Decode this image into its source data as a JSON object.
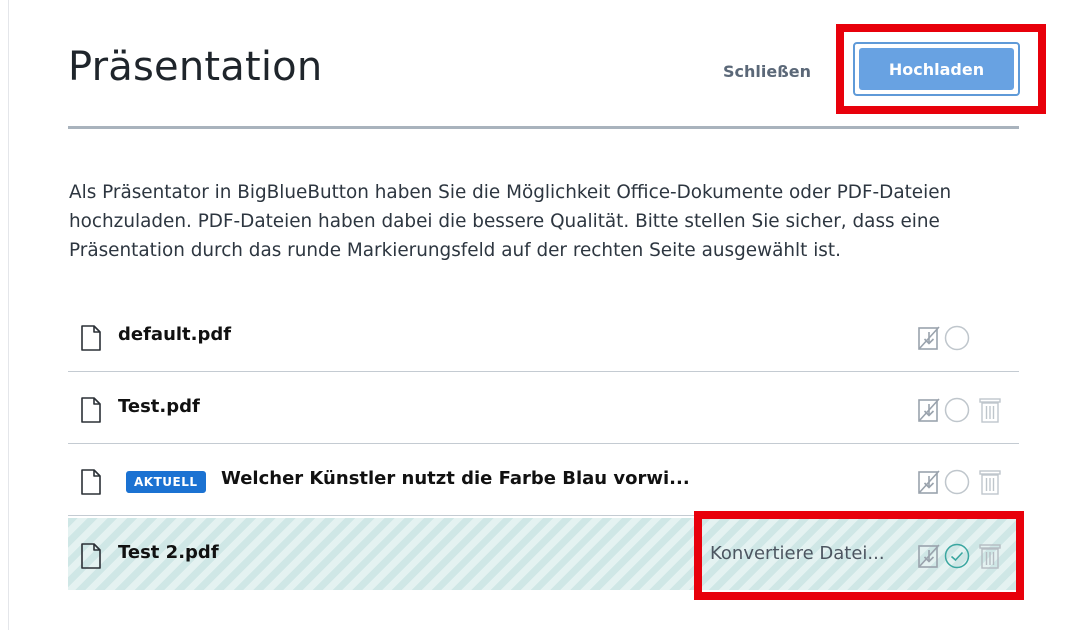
{
  "header": {
    "title": "Präsentation",
    "close_label": "Schließen",
    "upload_label": "Hochladen"
  },
  "description": "Als Präsentator in BigBlueButton haben Sie die Möglichkeit Office-Dokumente oder PDF-Dateien hochzuladen. PDF-Dateien haben dabei die bessere Qualität. Bitte stellen Sie sicher, dass eine Präsentation durch das runde Markierungsfeld auf der rechten Seite ausgewählt ist.",
  "files": [
    {
      "name": "default.pdf",
      "badge": "",
      "status": "",
      "selected": false,
      "deletable": false
    },
    {
      "name": "Test.pdf",
      "badge": "",
      "status": "",
      "selected": false,
      "deletable": true
    },
    {
      "name": "Welcher Künstler nutzt die Farbe Blau vorwi...",
      "badge": "AKTUELL",
      "status": "",
      "selected": false,
      "deletable": true
    },
    {
      "name": "Test 2.pdf",
      "badge": "",
      "status": "Konvertiere Datei...",
      "selected": true,
      "deletable": true
    }
  ],
  "icons": {
    "file": "file-icon",
    "download": "download-disabled-icon",
    "select": "radio-circle-icon",
    "selected": "check-circle-icon",
    "delete": "trash-icon"
  },
  "colors": {
    "upload_button": "#68a2e2",
    "badge": "#1b72d2",
    "selected_check": "#3aa6a0",
    "highlight_box": "#e8000b",
    "converting_row": "#cfe7e6"
  }
}
